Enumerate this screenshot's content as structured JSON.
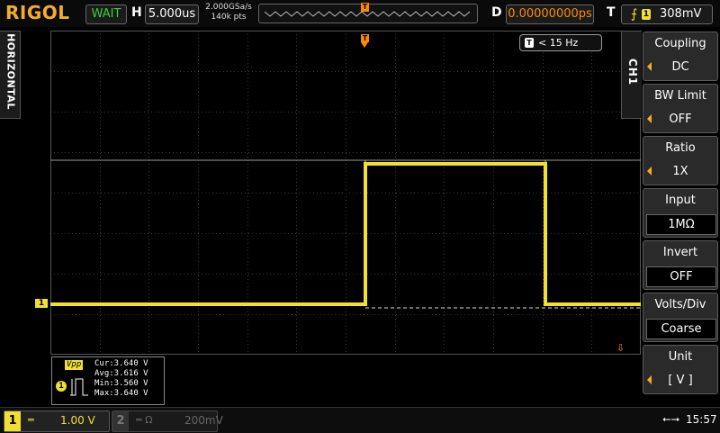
{
  "header": {
    "brand": "RIGOL",
    "run_status": "WAIT",
    "horizontal_label": "H",
    "timebase": "5.000us",
    "sample_rate": "2.000GSa/s",
    "memory_depth": "140k pts",
    "trigger_marker": "T",
    "delay_label": "D",
    "delay_value": "0.00000000ps",
    "trigger_label": "T",
    "trigger_edge_icon": "rising-edge-icon",
    "trigger_source": "1",
    "trigger_level": "308mV"
  },
  "left_tab": {
    "label": "HORIZONTAL"
  },
  "screen": {
    "trigger_marker": "T",
    "freq_icon": "T",
    "freq_text": "< 15 Hz",
    "ch1_marker": "1",
    "trigger_level_icon": "trigger-level-arrow-icon",
    "trace_color": "#f0e030",
    "trigger_color": "#ff8a00"
  },
  "measurement": {
    "label": "Vpp",
    "channel": "1",
    "cur": "Cur:3.640 V",
    "avg": "Avg:3.616 V",
    "min": "Min:3.560 V",
    "max": "Max:3.640 V"
  },
  "menu": {
    "tab_label": "CH1",
    "items": [
      {
        "title": "Coupling",
        "value": "DC"
      },
      {
        "title": "BW Limit",
        "value": "OFF"
      },
      {
        "title": "Ratio",
        "value": "1X"
      },
      {
        "title": "Input",
        "value": "1MΩ"
      },
      {
        "title": "Invert",
        "value": "OFF"
      },
      {
        "title": "Volts/Div",
        "value": "Coarse"
      },
      {
        "title": "Unit",
        "value": "[  V  ]"
      }
    ]
  },
  "footer": {
    "ch1_num": "1",
    "ch1_coupling": "═",
    "ch1_scale": "1.00 V",
    "ch2_num": "2",
    "ch2_coupling": "═ Ω",
    "ch2_scale": "200mV",
    "usb_icon": "usb-icon",
    "time": "15:57"
  }
}
